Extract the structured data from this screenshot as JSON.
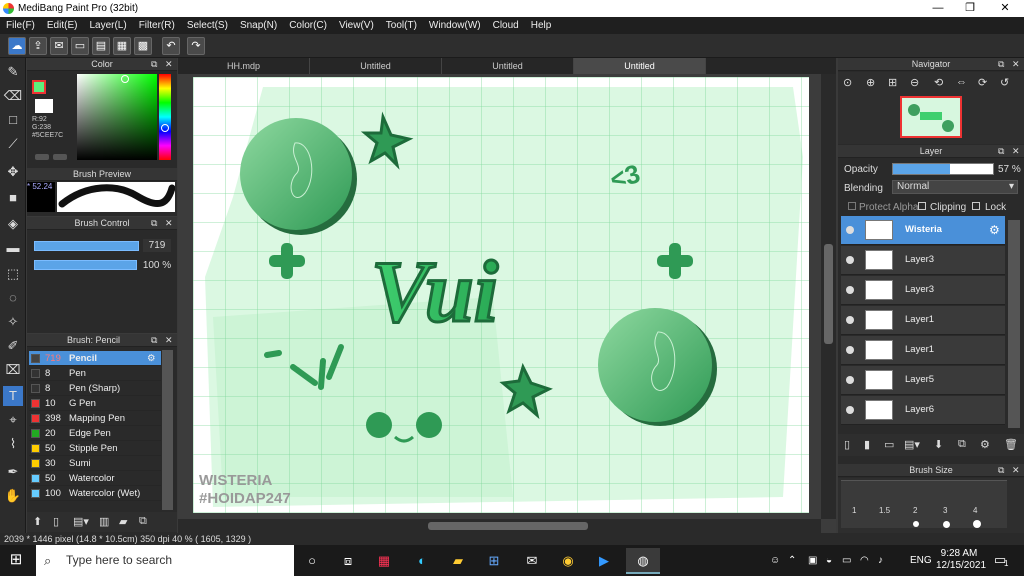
{
  "window": {
    "title": "MediBang Paint Pro (32bit)",
    "minimize": "—",
    "maximize": "❐",
    "close": "✕"
  },
  "menu": [
    "File(F)",
    "Edit(E)",
    "Layer(L)",
    "Filter(R)",
    "Select(S)",
    "Snap(N)",
    "Color(C)",
    "View(V)",
    "Tool(T)",
    "Window(W)",
    "Cloud",
    "Help"
  ],
  "color_panel": {
    "title": "Color",
    "r": "R:92",
    "g": "G:238",
    "hex": "#5CEE7C",
    "primary": "#5cee7c"
  },
  "brush_preview": {
    "title": "Brush Preview",
    "size": "* 52.24"
  },
  "brush_control": {
    "title": "Brush Control",
    "size": "719",
    "opacity": "100 %",
    "size_fraction": 0.92,
    "opacity_fraction": 1.0
  },
  "brush_list": {
    "title": "Brush: Pencil",
    "items": [
      {
        "num": "719",
        "name": "Pencil",
        "color": "#444",
        "active": true
      },
      {
        "num": "8",
        "name": "Pen",
        "color": "#333"
      },
      {
        "num": "8",
        "name": "Pen (Sharp)",
        "color": "#333"
      },
      {
        "num": "10",
        "name": "G Pen",
        "color": "#e33"
      },
      {
        "num": "398",
        "name": "Mapping Pen",
        "color": "#e33"
      },
      {
        "num": "20",
        "name": "Edge Pen",
        "color": "#2a2"
      },
      {
        "num": "50",
        "name": "Stipple Pen",
        "color": "#fc0"
      },
      {
        "num": "30",
        "name": "Sumi",
        "color": "#fc0"
      },
      {
        "num": "50",
        "name": "Watercolor",
        "color": "#6cf"
      },
      {
        "num": "100",
        "name": "Watercolor (Wet)",
        "color": "#6cf"
      }
    ]
  },
  "tabs": [
    "HH.mdp",
    "Untitled",
    "Untitled",
    "Untitled"
  ],
  "active_tab": 3,
  "artwork": {
    "title": "Vui",
    "watermark_line1": "WISTERIA",
    "watermark_line2": "#HOIDAP247",
    "heart_text": "<3"
  },
  "navigator": {
    "title": "Navigator"
  },
  "layer_panel": {
    "title": "Layer",
    "opacity_label": "Opacity",
    "opacity_value": "57 %",
    "opacity_fraction": 0.57,
    "blending_label": "Blending",
    "blending_value": "Normal",
    "protect_alpha": "Protect Alpha",
    "clipping": "Clipping",
    "lock": "Lock",
    "layers": [
      "Wisteria",
      "Layer3",
      "Layer3",
      "Layer1",
      "Layer1",
      "Layer5",
      "Layer6"
    ],
    "active_layer": 0
  },
  "brush_size": {
    "title": "Brush Size",
    "sizes": [
      "1",
      "1.5",
      "2",
      "3",
      "4"
    ]
  },
  "status": {
    "info": "2039 * 1446 pixel  (14.8 * 10.5cm)  350 dpi  40 %  ( 1605, 1329 )"
  },
  "taskbar": {
    "search_placeholder": "Type here to search",
    "time": "9:28 AM",
    "date": "12/15/2021",
    "lang": "ENG",
    "notif": "1"
  }
}
